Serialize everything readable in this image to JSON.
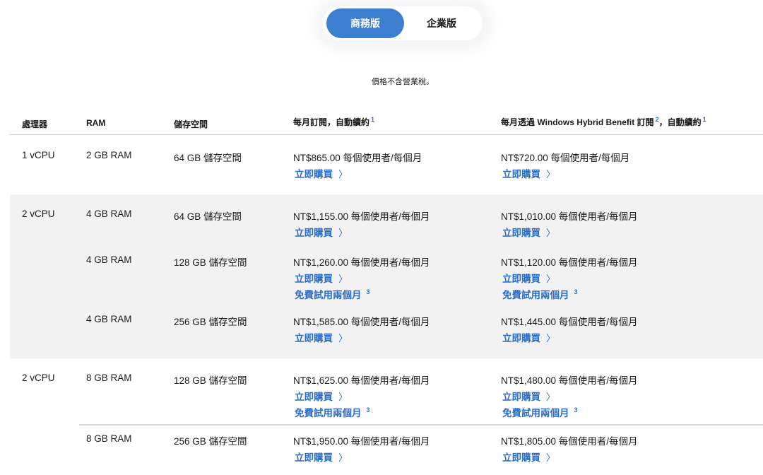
{
  "toggle": {
    "business_label": "商務版",
    "enterprise_label": "企業版",
    "selected": "商務版"
  },
  "price_note": "價格不含營業稅。",
  "headers": {
    "processor": "處理器",
    "ram": "RAM",
    "storage": "儲存空間",
    "monthly": "每月訂閱，自動續約",
    "monthly_sup": "1",
    "hybrid": "每月透過 Windows Hybrid Benefit 訂閱",
    "hybrid_sup": "2",
    "hybrid_suffix": "，自動續約",
    "hybrid_suffix_sup": "1"
  },
  "links": {
    "buy": "立即購買",
    "trial": "免費試用兩個月",
    "trial_sup": "3"
  },
  "rows": [
    {
      "cpu": "1 vCPU",
      "ram": "2 GB RAM",
      "storage": "64 GB 儲存空間",
      "monthly": "NT$865.00 每個使用者/每個月",
      "hybrid": "NT$720.00 每個使用者/每個月"
    },
    {
      "cpu": "2 vCPU",
      "ram": "4 GB RAM",
      "storage": "64 GB 儲存空間",
      "monthly": "NT$1,155.00 每個使用者/每個月",
      "hybrid": "NT$1,010.00 每個使用者/每個月"
    },
    {
      "cpu": "",
      "ram": "4 GB RAM",
      "storage": "128 GB 儲存空間",
      "monthly": "NT$1,260.00 每個使用者/每個月",
      "hybrid": "NT$1,120.00 每個使用者/每個月"
    },
    {
      "cpu": "",
      "ram": "4 GB RAM",
      "storage": "256 GB 儲存空間",
      "monthly": "NT$1,585.00 每個使用者/每個月",
      "hybrid": "NT$1,445.00 每個使用者/每個月"
    },
    {
      "cpu": "2 vCPU",
      "ram": "8 GB RAM",
      "storage": "128 GB 儲存空間",
      "monthly": "NT$1,625.00 每個使用者/每個月",
      "hybrid": "NT$1,480.00 每個使用者/每個月"
    },
    {
      "cpu": "",
      "ram": "8 GB RAM",
      "storage": "256 GB 儲存空間",
      "monthly": "NT$1,950.00 每個使用者/每個月",
      "hybrid": "NT$1,805.00 每個使用者/每個月"
    }
  ],
  "colors": {
    "accent": "#3c7fd1",
    "link": "#2b6cc4",
    "row_shade": "#f2f2f2"
  }
}
